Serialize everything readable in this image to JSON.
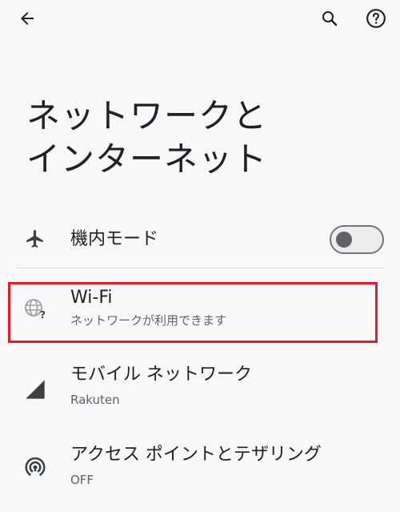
{
  "header": {
    "back_icon": "arrow-left-icon",
    "search_icon": "search-icon",
    "help_icon": "help-circle-icon"
  },
  "page": {
    "title": "ネットワークと\nインターネット"
  },
  "settings": {
    "airplane": {
      "icon": "airplane-icon",
      "label": "機内モード",
      "toggle_state": "off"
    },
    "wifi": {
      "icon": "wifi-question-globe-icon",
      "label": "Wi-Fi",
      "status": "ネットワークが利用できます"
    },
    "mobile": {
      "icon": "signal-triangle-icon",
      "label": "モバイル ネットワーク",
      "status": "Rakuten"
    },
    "hotspot": {
      "icon": "hotspot-icon",
      "label": "アクセス ポイントとテザリング",
      "status": "OFF"
    }
  },
  "colors": {
    "background": "#f8f8f8",
    "text_primary": "#202124",
    "text_secondary": "#5f6368",
    "highlight_border": "#e11d2a",
    "toggle_knob": "#5f6368"
  }
}
